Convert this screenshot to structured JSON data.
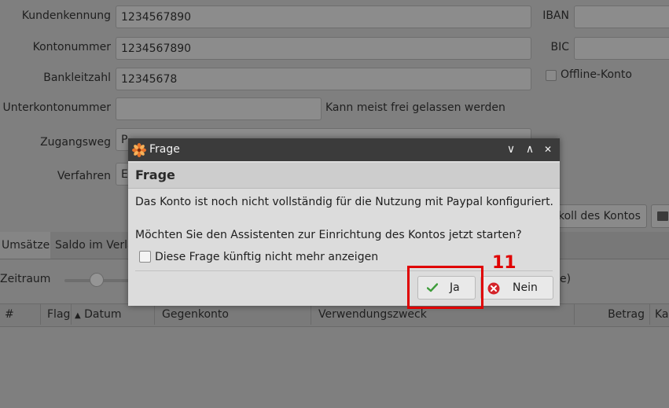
{
  "form": {
    "kundenkennung_label": "Kundenkennung",
    "kundenkennung_value": "1234567890",
    "kontonummer_label": "Kontonummer",
    "kontonummer_value": "1234567890",
    "bankleitzahl_label": "Bankleitzahl",
    "bankleitzahl_value": "12345678",
    "unterkontonummer_label": "Unterkontonummer",
    "unterkontonummer_value": "",
    "unterkontonummer_hint": "Kann meist frei gelassen werden",
    "zugangsweg_label": "Zugangsweg",
    "zugangsweg_value": "P",
    "verfahren_label": "Verfahren",
    "verfahren_value": "E",
    "iban_label": "IBAN",
    "bic_label": "BIC",
    "offline_label": "Offline-Konto",
    "protokoll_button": "koll des Kontos"
  },
  "tabs": [
    {
      "label": "Umsätze"
    },
    {
      "label": "Saldo im Verla"
    }
  ],
  "zeitraum_label": "Zeitraum",
  "zeitraum_suffix": "e)",
  "table": {
    "headers": [
      "#",
      "Flags",
      "Datum",
      "Gegenkonto",
      "Verwendungszweck",
      "Betrag",
      "Ka"
    ],
    "sort_arrow": "▲"
  },
  "dialog": {
    "title": "Frage",
    "header": "Frage",
    "message1": "Das Konto ist noch nicht vollständig für die Nutzung mit Paypal konfiguriert.",
    "message2": "Möchten Sie den Assistenten zur Einrichtung des Kontos jetzt starten?",
    "checkbox_label": "Diese Frage künftig nicht mehr anzeigen",
    "yes_label": "Ja",
    "no_label": "Nein",
    "minimize_glyph": "∨",
    "maximize_glyph": "∧",
    "close_glyph": "✕"
  },
  "annotation": {
    "number": "11",
    "color": "#e00000"
  }
}
